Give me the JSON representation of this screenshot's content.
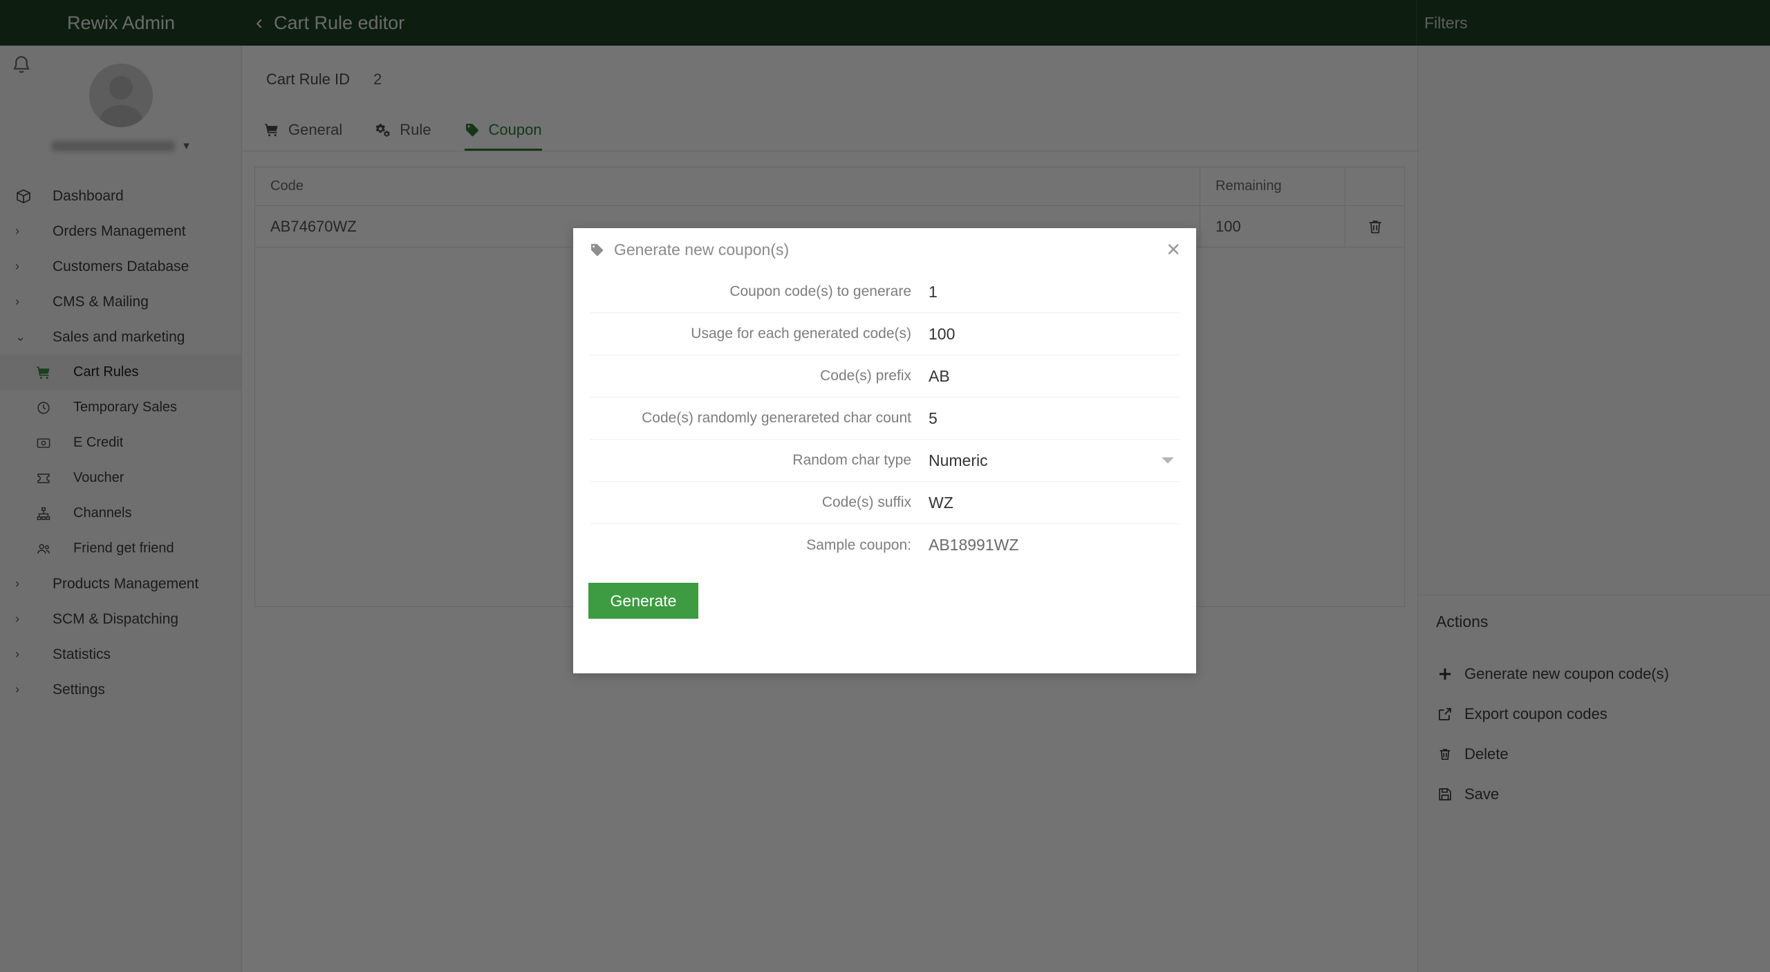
{
  "topbar": {
    "brand": "Rewix Admin",
    "page_title": "Cart Rule editor",
    "back_icon": "chevron-left-icon",
    "filters_label": "Filters"
  },
  "sidebar": {
    "notification_icon": "bell-icon",
    "user_caret_icon": "chevron-down-icon",
    "items": [
      {
        "label": "Dashboard",
        "icon": "cube-icon",
        "level": 0,
        "expander": "none",
        "active": false
      },
      {
        "label": "Orders Management",
        "icon": "none",
        "level": 0,
        "expander": "right",
        "active": false
      },
      {
        "label": "Customers Database",
        "icon": "none",
        "level": 0,
        "expander": "right",
        "active": false
      },
      {
        "label": "CMS & Mailing",
        "icon": "none",
        "level": 0,
        "expander": "right",
        "active": false
      },
      {
        "label": "Sales and marketing",
        "icon": "none",
        "level": 0,
        "expander": "down",
        "active": false
      },
      {
        "label": "Cart Rules",
        "icon": "cart-plus-icon",
        "level": 1,
        "expander": "none",
        "active": true
      },
      {
        "label": "Temporary Sales",
        "icon": "clock-icon",
        "level": 1,
        "expander": "none",
        "active": false
      },
      {
        "label": "E Credit",
        "icon": "credit-card-icon",
        "level": 1,
        "expander": "none",
        "active": false
      },
      {
        "label": "Voucher",
        "icon": "ticket-icon",
        "level": 1,
        "expander": "none",
        "active": false
      },
      {
        "label": "Channels",
        "icon": "sitemap-icon",
        "level": 1,
        "expander": "none",
        "active": false
      },
      {
        "label": "Friend get friend",
        "icon": "users-icon",
        "level": 1,
        "expander": "none",
        "active": false
      },
      {
        "label": "Products Management",
        "icon": "none",
        "level": 0,
        "expander": "right",
        "active": false
      },
      {
        "label": "SCM & Dispatching",
        "icon": "none",
        "level": 0,
        "expander": "right",
        "active": false
      },
      {
        "label": "Statistics",
        "icon": "none",
        "level": 0,
        "expander": "right",
        "active": false
      },
      {
        "label": "Settings",
        "icon": "none",
        "level": 0,
        "expander": "right",
        "active": false
      }
    ]
  },
  "main": {
    "cart_rule_id_label": "Cart Rule ID",
    "cart_rule_id_value": "2",
    "tabs": [
      {
        "label": "General",
        "icon": "cart-plus-icon",
        "active": false
      },
      {
        "label": "Rule",
        "icon": "cogs-icon",
        "active": false
      },
      {
        "label": "Coupon",
        "icon": "tag-icon",
        "active": true
      }
    ],
    "table": {
      "columns": [
        "Code",
        "Remaining",
        ""
      ],
      "rows": [
        {
          "code": "AB74670WZ",
          "remaining": "100",
          "action_icon": "trash-icon"
        }
      ]
    }
  },
  "right_panel": {
    "actions_title": "Actions",
    "actions": [
      {
        "label": "Generate new coupon code(s)",
        "icon": "plus-icon"
      },
      {
        "label": "Export coupon codes",
        "icon": "external-link-icon"
      },
      {
        "label": "Delete",
        "icon": "trash-icon"
      },
      {
        "label": "Save",
        "icon": "floppy-disk-icon"
      }
    ]
  },
  "modal": {
    "title": "Generate new coupon(s)",
    "title_icon": "tag-icon",
    "close_icon": "close-icon",
    "fields": [
      {
        "label": "Coupon code(s) to generare",
        "value": "1",
        "type": "text"
      },
      {
        "label": "Usage for each generated code(s)",
        "value": "100",
        "type": "text"
      },
      {
        "label": "Code(s) prefix",
        "value": "AB",
        "type": "text"
      },
      {
        "label": "Code(s) randomly generareted char count",
        "value": "5",
        "type": "text"
      },
      {
        "label": "Random char type",
        "value": "Numeric",
        "type": "select"
      },
      {
        "label": "Code(s) suffix",
        "value": "WZ",
        "type": "text"
      }
    ],
    "sample": {
      "label": "Sample coupon:",
      "value": "AB18991WZ"
    },
    "generate_button": "Generate"
  },
  "colors": {
    "header_green": "#1d4023",
    "accent_green": "#2f7a36",
    "button_green": "#3d9b41"
  }
}
